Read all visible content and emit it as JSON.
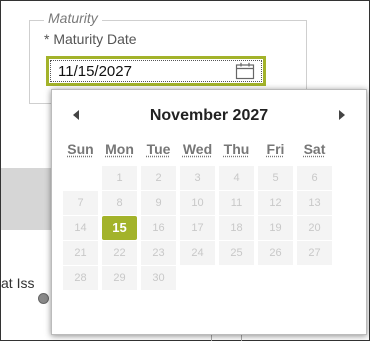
{
  "section": {
    "legend": "Maturity",
    "field_label": "* Maturity Date",
    "date_value": "11/15/2027"
  },
  "background": {
    "partial_label": "at Iss"
  },
  "calendar": {
    "month_label": "November",
    "year_label": "2027",
    "weekdays": [
      "Sun",
      "Mon",
      "Tue",
      "Wed",
      "Thu",
      "Fri",
      "Sat"
    ],
    "weeks": [
      [
        "",
        "1",
        "2",
        "3",
        "4",
        "5",
        "6"
      ],
      [
        "7",
        "8",
        "9",
        "10",
        "11",
        "12",
        "13"
      ],
      [
        "14",
        "15",
        "16",
        "17",
        "18",
        "19",
        "20"
      ],
      [
        "21",
        "22",
        "23",
        "24",
        "25",
        "26",
        "27"
      ],
      [
        "28",
        "29",
        "30",
        "",
        "",
        "",
        ""
      ]
    ],
    "selected_day": "15"
  },
  "colors": {
    "accent": "#a3b32a",
    "day_cell_bg": "#f4f4f4",
    "day_text": "#c8c8c8"
  },
  "icons": {
    "prev": "triangle-left-icon",
    "next": "triangle-right-icon",
    "calendar": "calendar-icon"
  }
}
